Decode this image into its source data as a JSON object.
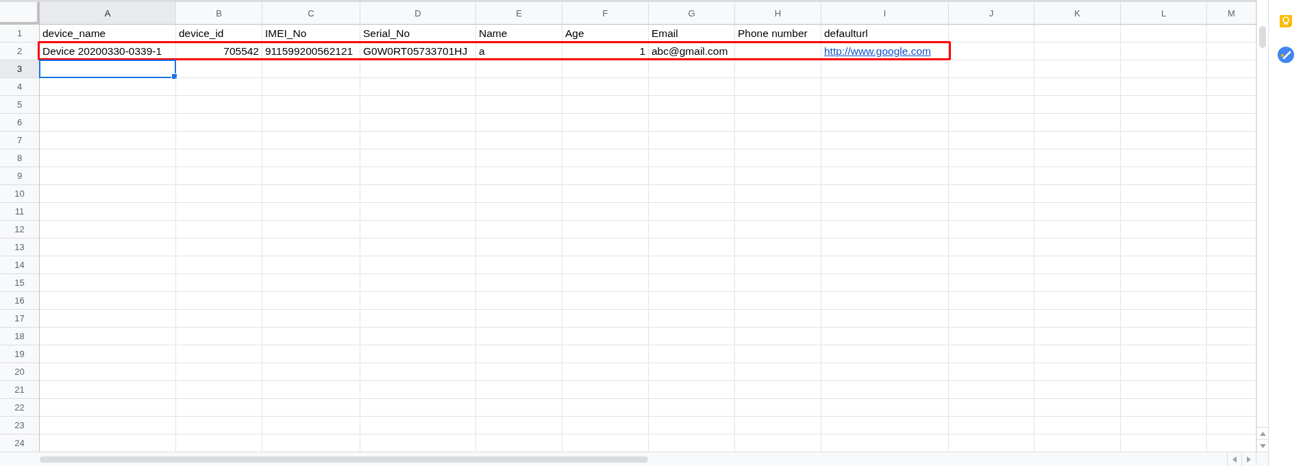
{
  "columns": [
    {
      "letter": "A",
      "selected": true
    },
    {
      "letter": "B",
      "selected": false
    },
    {
      "letter": "C",
      "selected": false
    },
    {
      "letter": "D",
      "selected": false
    },
    {
      "letter": "E",
      "selected": false
    },
    {
      "letter": "F",
      "selected": false
    },
    {
      "letter": "G",
      "selected": false
    },
    {
      "letter": "H",
      "selected": false
    },
    {
      "letter": "I",
      "selected": false
    },
    {
      "letter": "J",
      "selected": false
    },
    {
      "letter": "K",
      "selected": false
    },
    {
      "letter": "L",
      "selected": false
    },
    {
      "letter": "M",
      "selected": false
    }
  ],
  "rows": [
    {
      "number": "1",
      "selected": false,
      "outlined": false,
      "cells": [
        {
          "kind": "text",
          "text": "device_name"
        },
        {
          "kind": "text",
          "text": "device_id"
        },
        {
          "kind": "text",
          "text": "IMEI_No"
        },
        {
          "kind": "text",
          "text": "Serial_No"
        },
        {
          "kind": "text",
          "text": "Name"
        },
        {
          "kind": "text",
          "text": "Age"
        },
        {
          "kind": "text",
          "text": "Email"
        },
        {
          "kind": "text",
          "text": "Phone number"
        },
        {
          "kind": "text",
          "text": "defaulturl"
        }
      ]
    },
    {
      "number": "2",
      "selected": false,
      "outlined": true,
      "cells": [
        {
          "kind": "text",
          "text": "Device 20200330-0339-1"
        },
        {
          "kind": "number",
          "text": "705542"
        },
        {
          "kind": "text",
          "text": "911599200562121"
        },
        {
          "kind": "text",
          "text": "G0W0RT05733701HJ"
        },
        {
          "kind": "text",
          "text": "a"
        },
        {
          "kind": "number",
          "text": "1"
        },
        {
          "kind": "text",
          "text": "abc@gmail.com"
        },
        {
          "kind": "blank"
        },
        {
          "kind": "link",
          "text": "http://www.google.com"
        }
      ]
    },
    {
      "number": "3",
      "selected": true,
      "outlined": false
    },
    {
      "number": "4",
      "selected": false,
      "outlined": false
    },
    {
      "number": "5",
      "selected": false,
      "outlined": false
    },
    {
      "number": "6",
      "selected": false,
      "outlined": false
    },
    {
      "number": "7",
      "selected": false,
      "outlined": false
    },
    {
      "number": "8",
      "selected": false,
      "outlined": false
    },
    {
      "number": "9",
      "selected": false,
      "outlined": false
    },
    {
      "number": "10",
      "selected": false,
      "outlined": false
    },
    {
      "number": "11",
      "selected": false,
      "outlined": false
    },
    {
      "number": "12",
      "selected": false,
      "outlined": false
    },
    {
      "number": "13",
      "selected": false,
      "outlined": false
    },
    {
      "number": "14",
      "selected": false,
      "outlined": false
    },
    {
      "number": "15",
      "selected": false,
      "outlined": false
    },
    {
      "number": "16",
      "selected": false,
      "outlined": false
    },
    {
      "number": "17",
      "selected": false,
      "outlined": false
    },
    {
      "number": "18",
      "selected": false,
      "outlined": false
    },
    {
      "number": "19",
      "selected": false,
      "outlined": false
    },
    {
      "number": "20",
      "selected": false,
      "outlined": false
    },
    {
      "number": "21",
      "selected": false,
      "outlined": false
    },
    {
      "number": "22",
      "selected": false,
      "outlined": false
    },
    {
      "number": "23",
      "selected": false,
      "outlined": false
    },
    {
      "number": "24",
      "selected": false,
      "outlined": false
    }
  ]
}
